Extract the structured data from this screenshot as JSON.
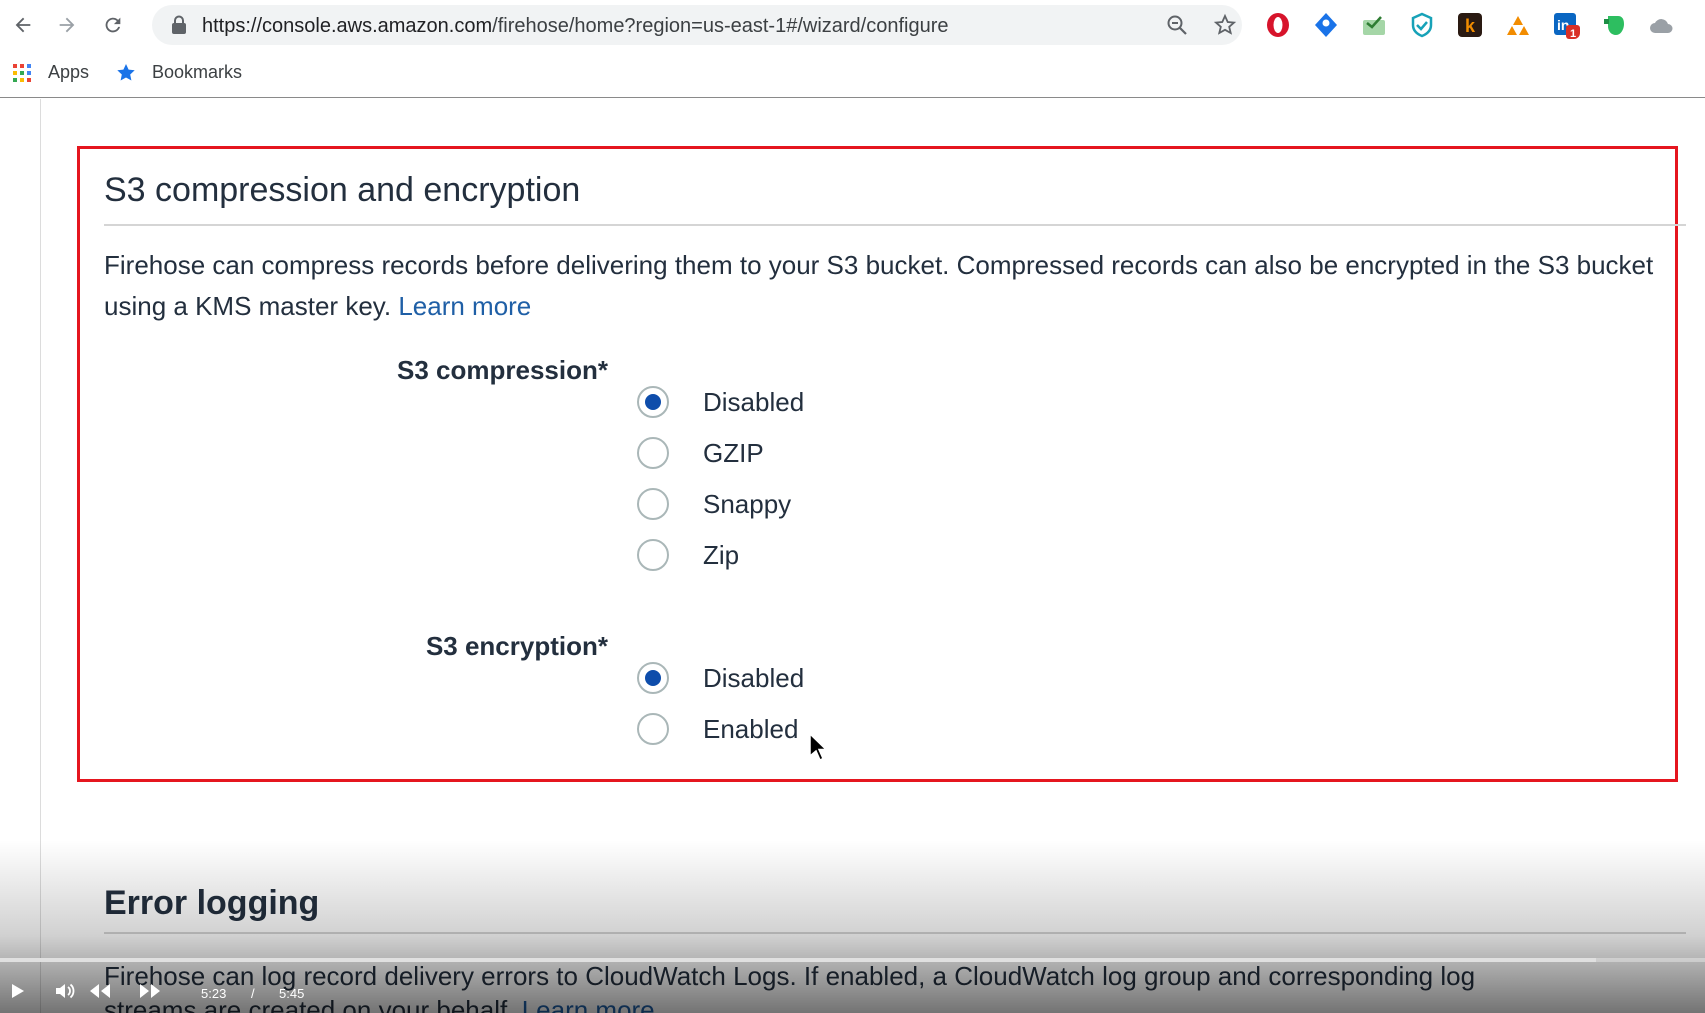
{
  "browser": {
    "url_host": "https://console.aws.amazon.com",
    "url_path": "/firehose/home?region=us-east-1#/wizard/configure",
    "bookmarks": [
      {
        "label": "Apps",
        "icon": "apps-grid-icon"
      },
      {
        "label": "Bookmarks",
        "icon": "star-icon"
      }
    ],
    "extensions": [
      {
        "name": "opera-extension-icon",
        "color": "#d7142b"
      },
      {
        "name": "location-pin-extension-icon",
        "color": "#1a73e8"
      },
      {
        "name": "mail-check-extension-icon",
        "color": "#4caf50"
      },
      {
        "name": "shield-extension-icon",
        "color": "#17a2b8"
      },
      {
        "name": "k-extension-icon",
        "color": "#2a1a12"
      },
      {
        "name": "triangles-extension-icon",
        "color": "#f28c00"
      },
      {
        "name": "linkedin-extension-icon",
        "color": "#0a66c2",
        "badge": "1"
      },
      {
        "name": "evernote-extension-icon",
        "color": "#2dbe60"
      },
      {
        "name": "cloud-extension-icon",
        "color": "#9aa0a6"
      }
    ]
  },
  "compression_section": {
    "title": "S3 compression and encryption",
    "description": "Firehose can compress records before delivering them to your S3 bucket. Compressed records can also be encrypted in the S3 bucket using a KMS master key.",
    "learn_more": "Learn more",
    "compression": {
      "label": "S3 compression*",
      "options": [
        "Disabled",
        "GZIP",
        "Snappy",
        "Zip"
      ],
      "selected": "Disabled"
    },
    "encryption": {
      "label": "S3 encryption*",
      "options": [
        "Disabled",
        "Enabled"
      ],
      "selected": "Disabled"
    },
    "highlight_color": "#e5161f"
  },
  "error_logging_section": {
    "title": "Error logging",
    "description": "Firehose can log record delivery errors to CloudWatch Logs. If enabled, a CloudWatch log group and corresponding log",
    "description_line2": "streams are created on your behalf.",
    "learn_more": "Learn more"
  },
  "video_player": {
    "current_time": "5:23",
    "separator": "/",
    "duration": "5:45",
    "progress_fraction": 0.936
  }
}
